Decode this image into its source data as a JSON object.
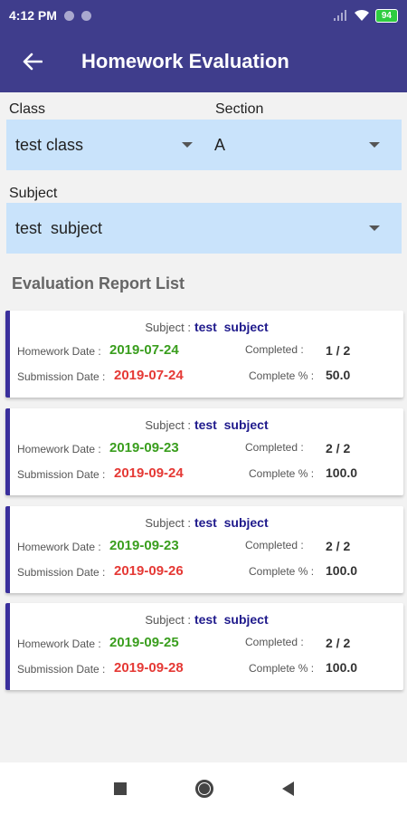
{
  "status": {
    "time": "4:12 PM",
    "battery": "94"
  },
  "header": {
    "title": "Homework Evaluation"
  },
  "filters": {
    "class_label": "Class",
    "class_value": "test class",
    "section_label": "Section",
    "section_value": "A",
    "subject_label": "Subject",
    "subject_value": "test  subject"
  },
  "list_title": "Evaluation Report List",
  "labels": {
    "subject": "Subject :",
    "homework_date": "Homework Date :",
    "submission_date": "Submission Date :",
    "completed": "Completed :",
    "complete_pct": "Complete % :"
  },
  "reports": [
    {
      "subject": "test  subject",
      "homework_date": "2019-07-24",
      "submission_date": "2019-07-24",
      "completed": "1 / 2",
      "complete_pct": "50.0"
    },
    {
      "subject": "test  subject",
      "homework_date": "2019-09-23",
      "submission_date": "2019-09-24",
      "completed": "2 / 2",
      "complete_pct": "100.0"
    },
    {
      "subject": "test  subject",
      "homework_date": "2019-09-23",
      "submission_date": "2019-09-26",
      "completed": "2 / 2",
      "complete_pct": "100.0"
    },
    {
      "subject": "test  subject",
      "homework_date": "2019-09-25",
      "submission_date": "2019-09-28",
      "completed": "2 / 2",
      "complete_pct": "100.0"
    }
  ],
  "icons": {
    "back": "arrow-left-icon",
    "dropdown": "caret-down-icon",
    "nav": [
      "square-icon",
      "circle-icon",
      "triangle-back-icon"
    ]
  },
  "colors": {
    "appbar": "#3f3d8c",
    "dropdown_bg": "#c9e3fb",
    "homework_date": "#3a9e1e",
    "submission_date": "#e53935",
    "subject_value": "#1f1a8c"
  }
}
